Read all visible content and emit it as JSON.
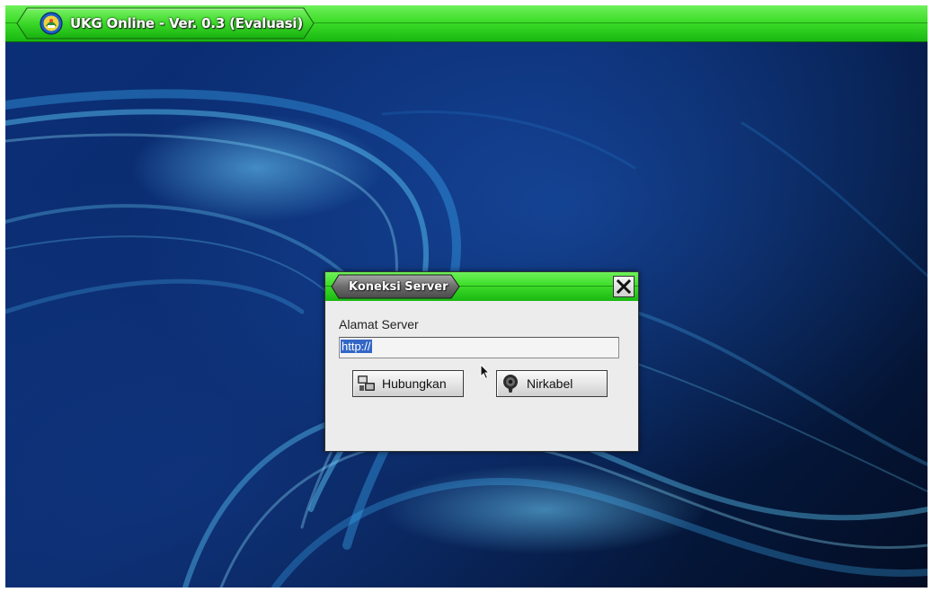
{
  "app": {
    "title": "UKG Online - Ver. 0.3 (Evaluasi)",
    "logo_icon": "emblem-logo-icon"
  },
  "dialog": {
    "title": "Koneksi Server",
    "close_icon": "close-x-icon",
    "server_label": "Alamat Server",
    "server_input": {
      "value": "http://",
      "selected": true
    },
    "buttons": {
      "connect_label": "Hubungkan",
      "connect_icon": "network-computers-icon",
      "wireless_label": "Nirkabel",
      "wireless_icon": "wireless-antenna-icon"
    }
  },
  "colors": {
    "titlebar_green": "#3ede2a",
    "dialog_bg": "#ececec",
    "selection_blue": "#3367c6",
    "desktop_blue": "#0b2f77"
  }
}
